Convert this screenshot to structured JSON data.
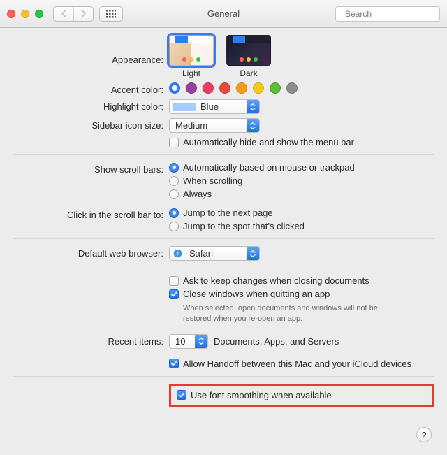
{
  "window": {
    "title": "General"
  },
  "toolbar": {
    "search_placeholder": "Search"
  },
  "appearance": {
    "label": "Appearance:",
    "light": "Light",
    "dark": "Dark",
    "selected": "light"
  },
  "accent": {
    "label": "Accent color:",
    "colors": [
      "#2f7df6",
      "#9a3ea0",
      "#ee3b66",
      "#e84a3d",
      "#f29b1d",
      "#f6c71b",
      "#5bbb3a",
      "#8e8e8e"
    ],
    "selected_index": 0
  },
  "highlight": {
    "label": "Highlight color:",
    "value": "Blue"
  },
  "sidebar": {
    "label": "Sidebar icon size:",
    "value": "Medium"
  },
  "menubar_hide": {
    "label": "Automatically hide and show the menu bar",
    "checked": false
  },
  "scrollbars": {
    "label": "Show scroll bars:",
    "options": [
      "Automatically based on mouse or trackpad",
      "When scrolling",
      "Always"
    ],
    "selected_index": 0
  },
  "click_scroll": {
    "label": "Click in the scroll bar to:",
    "options": [
      "Jump to the next page",
      "Jump to the spot that’s clicked"
    ],
    "selected_index": 0
  },
  "browser": {
    "label": "Default web browser:",
    "value": "Safari"
  },
  "ask_changes": {
    "label": "Ask to keep changes when closing documents",
    "checked": false
  },
  "close_windows": {
    "label": "Close windows when quitting an app",
    "checked": true,
    "note": "When selected, open documents and windows will not be restored when you re-open an app."
  },
  "recent": {
    "label": "Recent items:",
    "value": "10",
    "suffix": "Documents, Apps, and Servers"
  },
  "handoff": {
    "label": "Allow Handoff between this Mac and your iCloud devices",
    "checked": true
  },
  "font_smoothing": {
    "label": "Use font smoothing when available",
    "checked": true
  },
  "help": {
    "label": "?"
  }
}
